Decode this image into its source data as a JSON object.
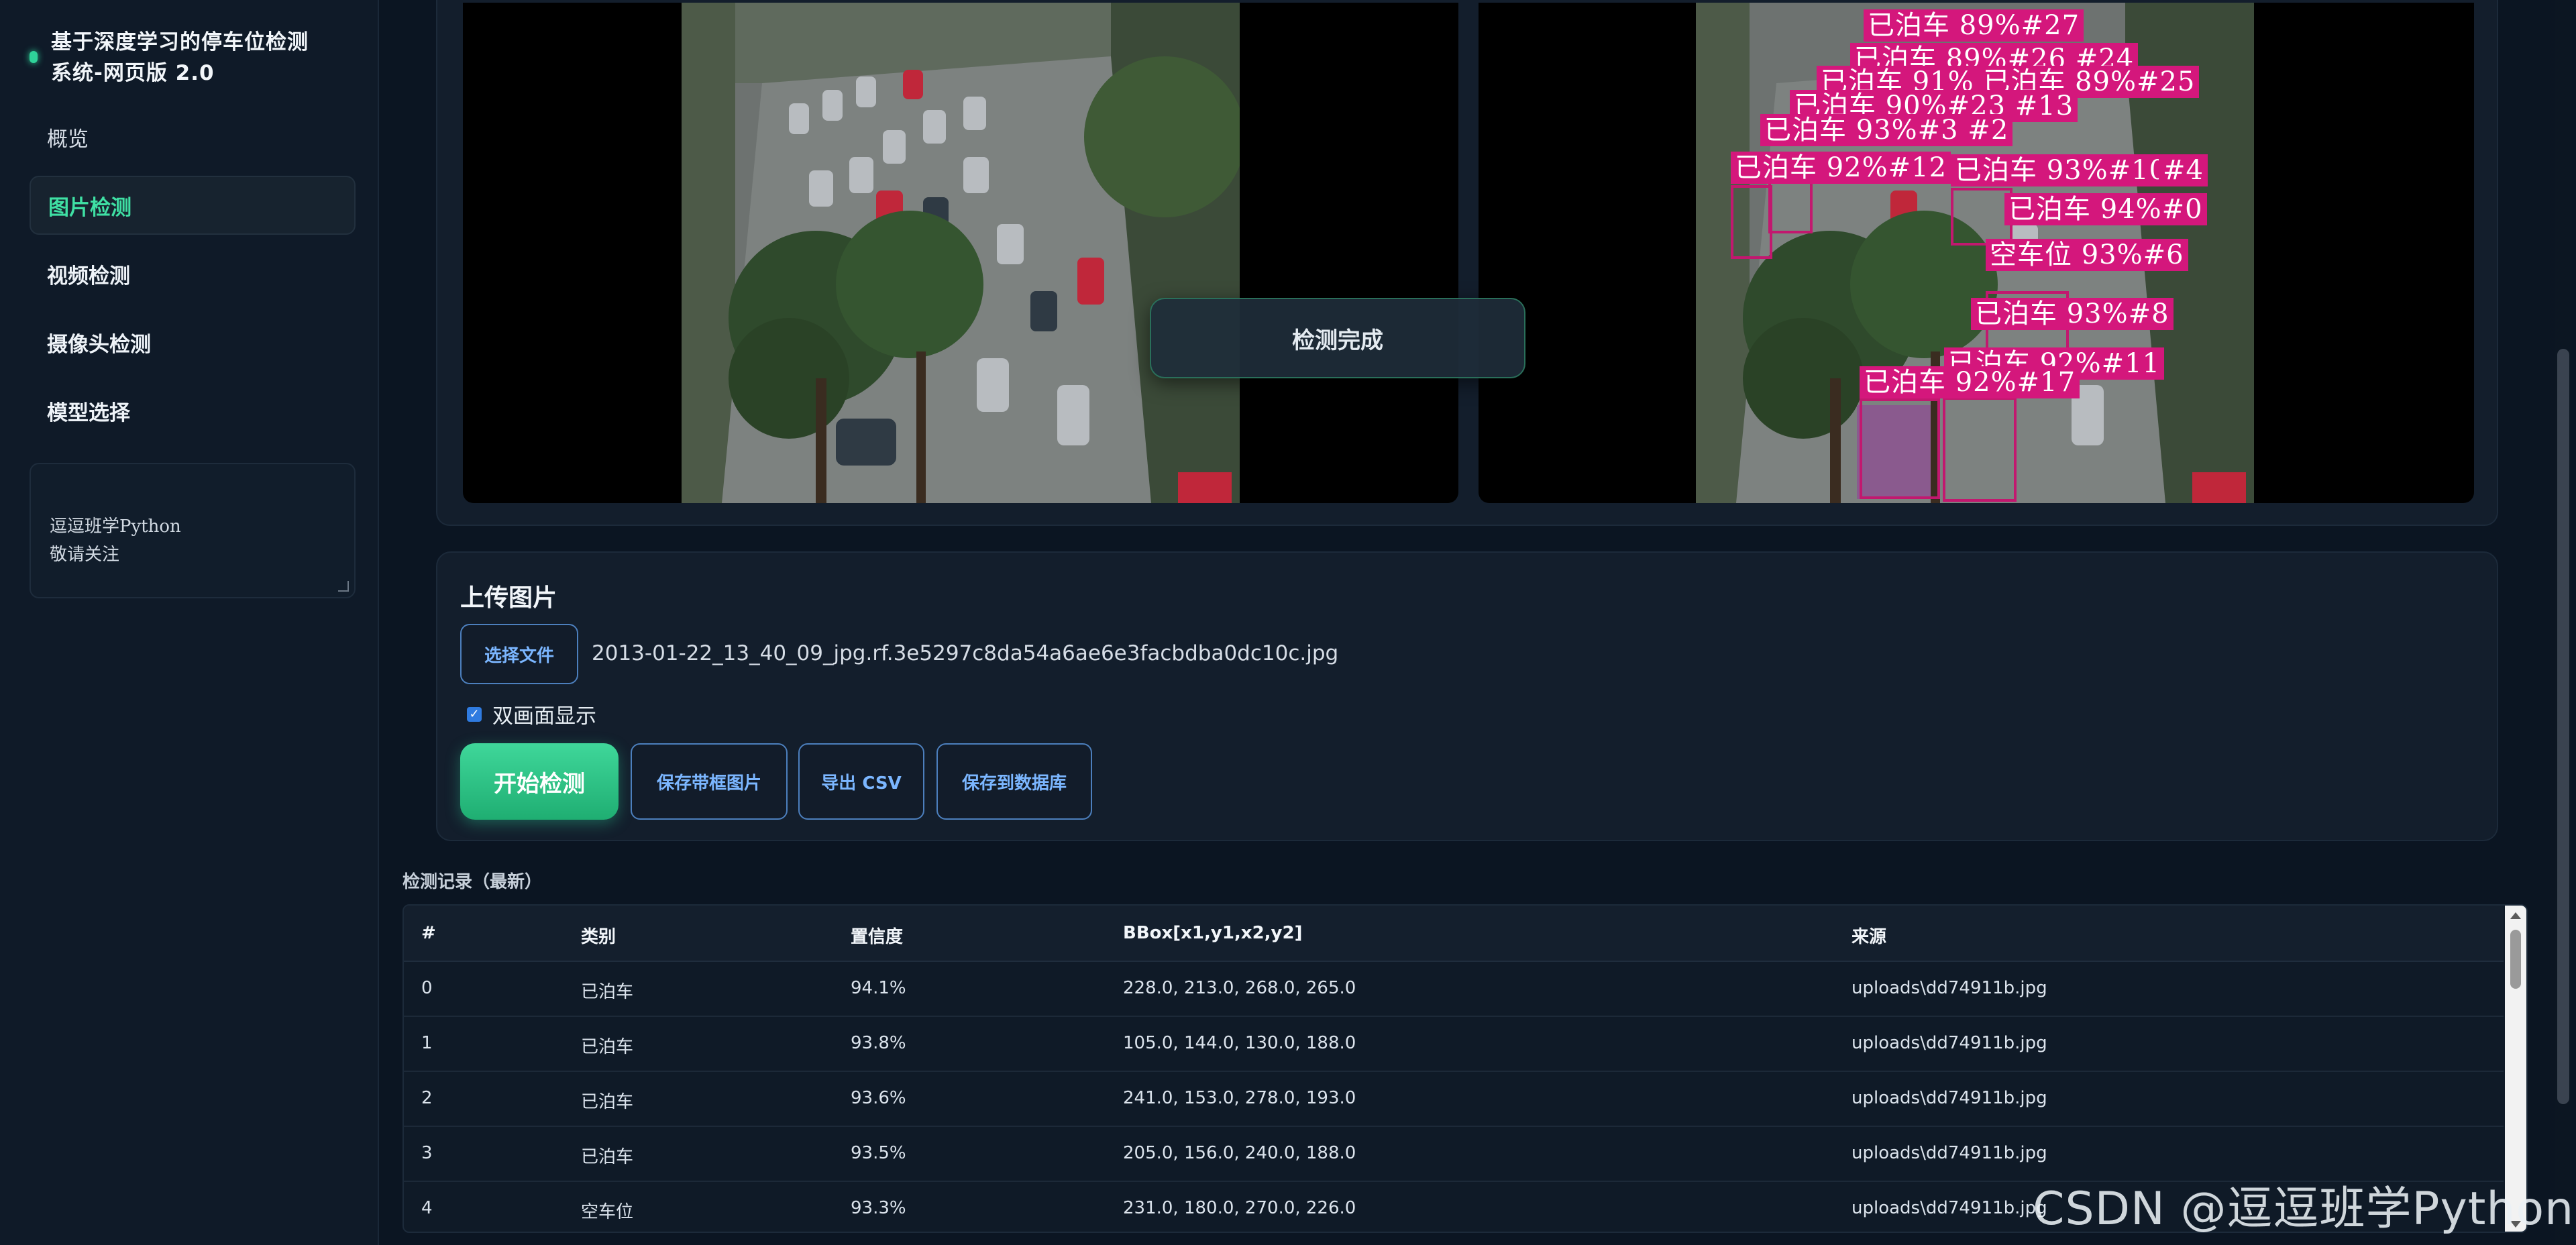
{
  "app": {
    "title": "基于深度学习的停车位检测\n系统-网页版 2.0",
    "accent": "#2fd39a"
  },
  "sidebar": {
    "items": [
      {
        "label": "概览",
        "active": false
      },
      {
        "label": "图片检测",
        "active": true
      },
      {
        "label": "视频检测",
        "active": false
      },
      {
        "label": "摄像头检测",
        "active": false
      },
      {
        "label": "模型选择",
        "active": false
      }
    ],
    "notes": "逗逗班学Python\n敬请关注"
  },
  "preview": {
    "toast": "检测完成",
    "labels": [
      "已泊车 89%#27",
      "已泊车 89%#26 #24",
      "已泊车 91% 已泊车 89%#25",
      "已泊车 90%#23 #13",
      "已泊车 93%#3 #2",
      "已泊车 92%#12",
      "已泊车 93%#10",
      "#4",
      "已泊车 94%#0",
      "空车位 93%#6",
      "已泊车 93%#8",
      "已泊车 92%#11",
      "已泊车 92%#17"
    ],
    "label_color": "#d4177c"
  },
  "upload": {
    "title": "上传图片",
    "choose_label": "选择文件",
    "file_name": "2013-01-22_13_40_09_jpg.rf.3e5297c8da54a6ae6e3facbdba0dc10c.jpg",
    "dual_view_label": "双画面显示",
    "dual_view_checked": true,
    "start_label": "开始检测",
    "save_image_label": "保存带框图片",
    "export_csv_label": "导出 CSV",
    "save_db_label": "保存到数据库"
  },
  "records": {
    "title": "检测记录（最新）",
    "columns": [
      "#",
      "类别",
      "置信度",
      "BBox[x1,y1,x2,y2]",
      "来源"
    ],
    "rows": [
      [
        "0",
        "已泊车",
        "94.1%",
        "228.0, 213.0, 268.0, 265.0",
        "uploads\\dd74911b.jpg"
      ],
      [
        "1",
        "已泊车",
        "93.8%",
        "105.0, 144.0, 130.0, 188.0",
        "uploads\\dd74911b.jpg"
      ],
      [
        "2",
        "已泊车",
        "93.6%",
        "241.0, 153.0, 278.0, 193.0",
        "uploads\\dd74911b.jpg"
      ],
      [
        "3",
        "已泊车",
        "93.5%",
        "205.0, 156.0, 240.0, 188.0",
        "uploads\\dd74911b.jpg"
      ],
      [
        "4",
        "空车位",
        "93.3%",
        "231.0, 180.0, 270.0, 226.0",
        "uploads\\dd74911b.jpg"
      ]
    ]
  },
  "watermark": "CSDN @逗逗班学Python"
}
